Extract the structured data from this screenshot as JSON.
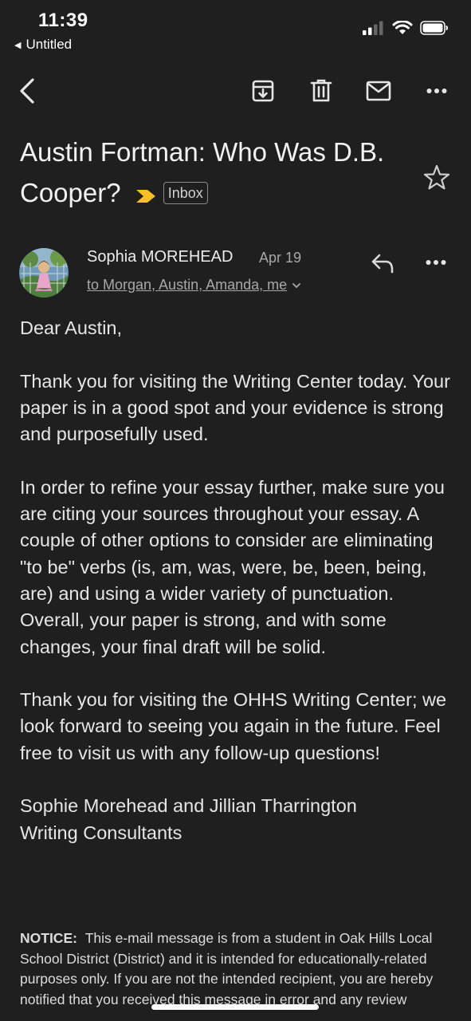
{
  "status_bar": {
    "time": "11:39",
    "back_app_label": "Untitled"
  },
  "toolbar": {
    "back": "back-arrow-icon",
    "archive": "archive-icon",
    "delete": "trash-icon",
    "mark_unread": "mail-icon",
    "more": "more-icon"
  },
  "email": {
    "subject": "Austin Fortman: Who Was D.B. Cooper?",
    "label": "Inbox",
    "sender": "Sophia MOREHEAD",
    "date": "Apr 19",
    "recipients": "to Morgan, Austin, Amanda, me",
    "body": {
      "greeting": "Dear Austin,",
      "p1": "Thank you for visiting the Writing Center today. Your paper is in a good spot and your evidence is strong and purposefully used.",
      "p2": "In order to refine your essay further, make sure you are citing your sources throughout your essay. A couple of other options to consider are eliminating \"to be\" verbs (is, am, was, were, be, been, being, are) and using a wider variety of punctuation. Overall, your paper is strong, and with some changes, your final draft will be solid.",
      "p3": "Thank you for visiting the OHHS Writing Center; we look forward to seeing you again in the future. Feel free to visit us with any follow-up questions!",
      "sig_line1": "Sophie Morehead and Jillian Tharrington",
      "sig_line2": "Writing Consultants"
    },
    "notice_label": "NOTICE:",
    "notice_text": "This e-mail message is from a student in Oak Hills Local School District (District) and it is intended for educationally-related purposes only.  If you are not the intended recipient, you are hereby notified that you received this message in error and any review"
  },
  "colors": {
    "background": "#1f1f20",
    "important_marker": "#f6c026"
  }
}
